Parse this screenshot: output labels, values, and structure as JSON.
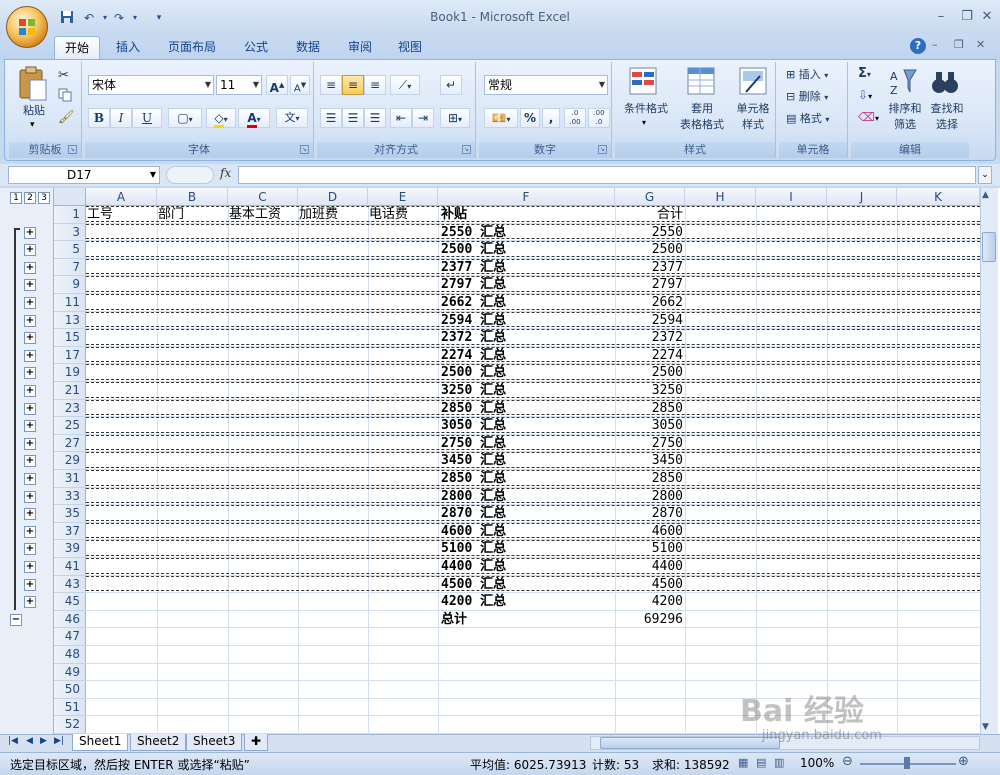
{
  "window": {
    "title": "Book1 - Microsoft Excel"
  },
  "qat": {
    "save_icon": "save-icon",
    "undo_icon": "undo-icon",
    "redo_icon": "redo-icon"
  },
  "tabs": [
    "开始",
    "插入",
    "页面布局",
    "公式",
    "数据",
    "审阅",
    "视图"
  ],
  "ribbon": {
    "clipboard": {
      "paste": "粘贴",
      "group": "剪贴板"
    },
    "font": {
      "name": "宋体",
      "size": "11",
      "group": "字体",
      "bold": "B",
      "italic": "I",
      "underline": "U",
      "grow": "A",
      "shrink": "A",
      "font_color": "A",
      "phonetic": "文"
    },
    "alignment": {
      "group": "对齐方式"
    },
    "number": {
      "format": "常规",
      "percent": "%",
      "comma": ",",
      "inc_dec": ".0\n.00",
      "dec_dec": ".00\n.0",
      "group": "数字"
    },
    "styles": {
      "conditional": "条件格式",
      "table1": "套用",
      "table2": "表格格式",
      "cell1": "单元格",
      "cell2": "样式",
      "group": "样式"
    },
    "cells": {
      "insert": "插入",
      "delete": "删除",
      "format": "格式",
      "group": "单元格"
    },
    "editing": {
      "sort1": "排序和",
      "sort2": "筛选",
      "find1": "查找和",
      "find2": "选择",
      "sigma": "Σ",
      "group": "编辑"
    }
  },
  "formula_bar": {
    "name_box": "D17",
    "fx": "fx",
    "value": ""
  },
  "outline_levels": [
    "1",
    "2",
    "3"
  ],
  "columns": [
    "A",
    "B",
    "C",
    "D",
    "E",
    "F",
    "G",
    "H",
    "I",
    "J",
    "K"
  ],
  "rows": [
    {
      "num": "1",
      "a": "工号",
      "b": "部门",
      "c": "基本工资",
      "d": "加班费",
      "e": "电话费",
      "f": "补贴",
      "g": "合计"
    },
    {
      "num": "3",
      "f": "2550 汇总",
      "g": "2550"
    },
    {
      "num": "5",
      "f": "2500 汇总",
      "g": "2500"
    },
    {
      "num": "7",
      "f": "2377 汇总",
      "g": "2377"
    },
    {
      "num": "9",
      "f": "2797 汇总",
      "g": "2797"
    },
    {
      "num": "11",
      "f": "2662 汇总",
      "g": "2662"
    },
    {
      "num": "13",
      "f": "2594 汇总",
      "g": "2594"
    },
    {
      "num": "15",
      "f": "2372 汇总",
      "g": "2372"
    },
    {
      "num": "17",
      "f": "2274 汇总",
      "g": "2274"
    },
    {
      "num": "19",
      "f": "2500 汇总",
      "g": "2500"
    },
    {
      "num": "21",
      "f": "3250 汇总",
      "g": "3250"
    },
    {
      "num": "23",
      "f": "2850 汇总",
      "g": "2850"
    },
    {
      "num": "25",
      "f": "3050 汇总",
      "g": "3050"
    },
    {
      "num": "27",
      "f": "2750 汇总",
      "g": "2750"
    },
    {
      "num": "29",
      "f": "3450 汇总",
      "g": "3450"
    },
    {
      "num": "31",
      "f": "2850 汇总",
      "g": "2850"
    },
    {
      "num": "33",
      "f": "2800 汇总",
      "g": "2800"
    },
    {
      "num": "35",
      "f": "2870 汇总",
      "g": "2870"
    },
    {
      "num": "37",
      "f": "4600 汇总",
      "g": "4600"
    },
    {
      "num": "39",
      "f": "5100 汇总",
      "g": "5100"
    },
    {
      "num": "41",
      "f": "4400 汇总",
      "g": "4400"
    },
    {
      "num": "43",
      "f": "4500 汇总",
      "g": "4500"
    },
    {
      "num": "45",
      "f": "4200 汇总",
      "g": "4200"
    },
    {
      "num": "46",
      "f": "总计",
      "g": "69296"
    },
    {
      "num": "47"
    },
    {
      "num": "48"
    },
    {
      "num": "49"
    },
    {
      "num": "50"
    },
    {
      "num": "51"
    },
    {
      "num": "52"
    }
  ],
  "sheets": [
    "Sheet1",
    "Sheet2",
    "Sheet3"
  ],
  "status": {
    "message": "选定目标区域，然后按 ENTER 或选择“粘贴”",
    "average": "平均值: 6025.73913",
    "count": "计数: 53",
    "sum": "求和: 138592",
    "zoom": "100%"
  },
  "watermark": {
    "text": "Bai 经验",
    "url": "jingyan.baidu.com"
  }
}
